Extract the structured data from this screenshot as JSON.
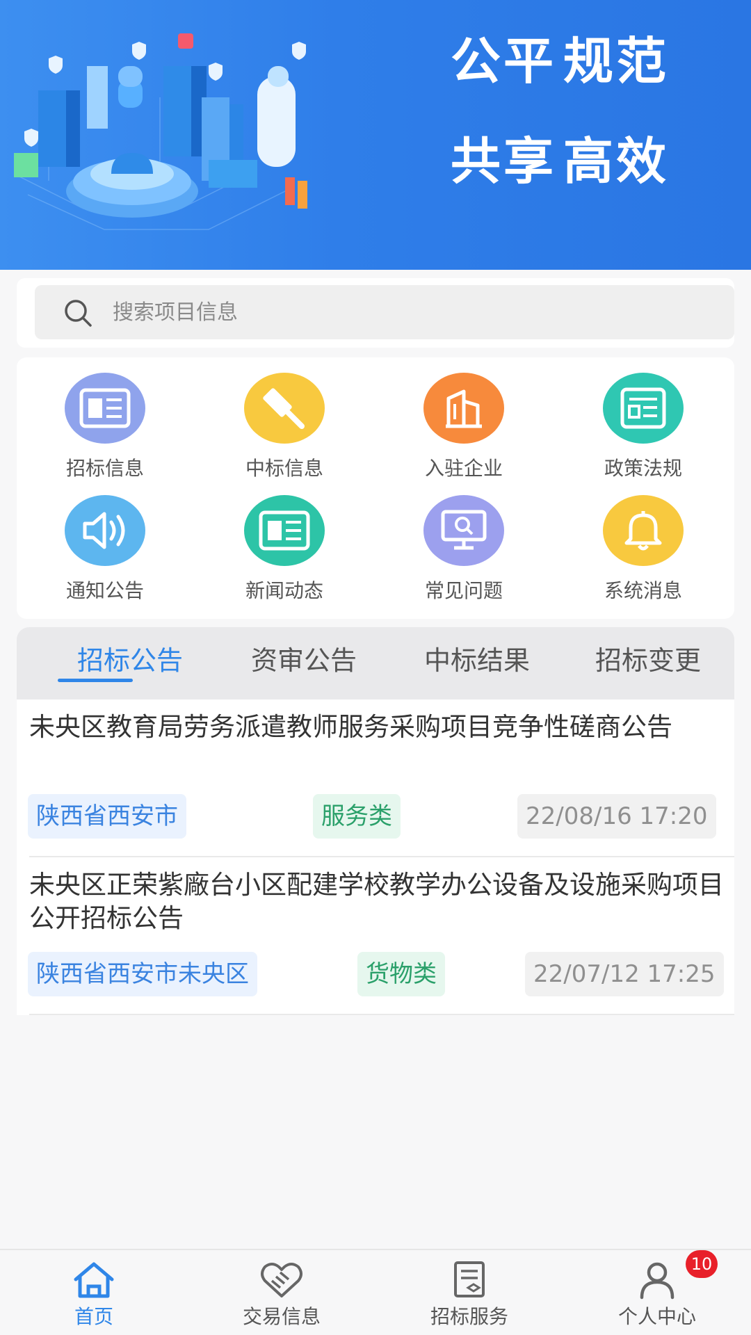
{
  "banner": {
    "slogan": [
      "公平",
      "规范",
      "共享",
      "高效"
    ]
  },
  "search": {
    "placeholder": "搜索项目信息",
    "value": ""
  },
  "grid": [
    {
      "label": "招标信息",
      "icon": "newspaper-icon",
      "color": "#8fa3ec"
    },
    {
      "label": "中标信息",
      "icon": "gavel-icon",
      "color": "#f8c93f"
    },
    {
      "label": "入驻企业",
      "icon": "building-icon",
      "color": "#f78a3c"
    },
    {
      "label": "政策法规",
      "icon": "document-icon",
      "color": "#2fc7b2"
    },
    {
      "label": "通知公告",
      "icon": "speaker-icon",
      "color": "#5db6ef"
    },
    {
      "label": "新闻动态",
      "icon": "news-icon",
      "color": "#2dc4a7"
    },
    {
      "label": "常见问题",
      "icon": "monitor-search-icon",
      "color": "#9ca0ee"
    },
    {
      "label": "系统消息",
      "icon": "bell-icon",
      "color": "#f8c93f"
    }
  ],
  "tabs": [
    {
      "label": "招标公告",
      "active": true
    },
    {
      "label": "资审公告",
      "active": false
    },
    {
      "label": "中标结果",
      "active": false
    },
    {
      "label": "招标变更",
      "active": false
    }
  ],
  "list": [
    {
      "title": "未央区教育局劳务派遣教师服务采购项目竞争性磋商公告",
      "region": "陕西省西安市",
      "category": "服务类",
      "time": "22/08/16 17:20"
    },
    {
      "title": "未央区正荣紫廠台小区配建学校教学办公设备及设施采购项目公开招标公告",
      "region": "陕西省西安市未央区",
      "category": "货物类",
      "time": "22/07/12 17:25"
    }
  ],
  "nav": [
    {
      "label": "首页",
      "icon": "home-icon",
      "active": true
    },
    {
      "label": "交易信息",
      "icon": "handshake-icon",
      "active": false
    },
    {
      "label": "招标服务",
      "icon": "service-doc-icon",
      "active": false
    },
    {
      "label": "个人中心",
      "icon": "user-icon",
      "active": false,
      "badge": "10"
    }
  ],
  "colors": {
    "accent": "#2f86e8",
    "banner": "#2f7ee9",
    "badge": "#e8202a"
  }
}
